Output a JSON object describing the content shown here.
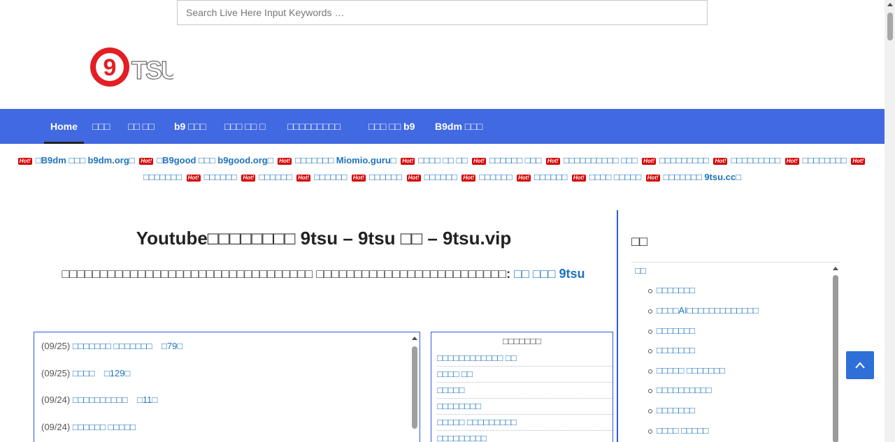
{
  "search": {
    "placeholder": "Search Live Here Input Keywords …"
  },
  "logo": {
    "text": "TSU",
    "digit": "9"
  },
  "nav": [
    {
      "label": "Home"
    },
    {
      "label": "□□□"
    },
    {
      "label": "□□ □□"
    },
    {
      "label": "b9 □□□"
    },
    {
      "label": "□□□ □□ □"
    },
    {
      "label": "□□□□□□□□□"
    },
    {
      "label": "□□□ □□ b9"
    },
    {
      "label": "B9dm □□□"
    }
  ],
  "hot_badge": "Hot!",
  "hot_links": [
    "□B9dm □□□ b9dm.org□",
    "□B9good □□□ b9good.org□",
    "□□□□□□□ Miomio.guru□",
    "□□□□ □□ □□",
    "□□□□□□ □□□",
    "□□□□□□□□□□ □□□",
    "□□□□□□□□□",
    "□□□□□□□□□",
    "□□□□□□□□",
    "□□□□□□□",
    "□□□□□□",
    "□□□□□□",
    "□□□□□□",
    "□□□□□□",
    "□□□□□□",
    "□□□□□□",
    "□□□□□□",
    "□□□□ □□□□□",
    "□□□□□□□ 9tsu.cc□"
  ],
  "main": {
    "title": "Youtube□□□□□□□□ 9tsu – 9tsu □□ – 9tsu.vip",
    "notice_text": "□□□□□□□□□□□□□□□□□□□□□□□□□□□□□□□□□ □□□□□□□□□□□□□□□□□□□□□□□□□: ",
    "notice_link": "□□ □□□ 9tsu"
  },
  "updates": [
    {
      "date": "(09/25)",
      "title": "□□□□□□□ □□□□□□□",
      "count": "□79□"
    },
    {
      "date": "(09/25)",
      "title": "□□□□",
      "count": "□129□"
    },
    {
      "date": "(09/24)",
      "title": "□□□□□□□□□□",
      "count": "□11□"
    },
    {
      "date": "(09/24)",
      "title": "□□□□□□ □□□□□",
      "count": ""
    }
  ],
  "categories": {
    "title": "□□□□□□□",
    "items": [
      "□□□□□□□□□□□□ □□",
      "□□□□ □□",
      "□□□□□",
      "□□□□□□□□",
      "□□□□□ □□□□□□□□□",
      "□□□□□□□□□"
    ]
  },
  "sidebar": {
    "title": "□□",
    "root": "□□",
    "items": [
      "□□□□□□□",
      "□□□□AI□□□□□□□□□□□□□",
      "□□□□□□□",
      "□□□□□□□",
      "□□□□□ □□□□□□□",
      "□□□□□□□□□□",
      "□□□□□□□",
      "□□□□ □□□□□"
    ]
  }
}
